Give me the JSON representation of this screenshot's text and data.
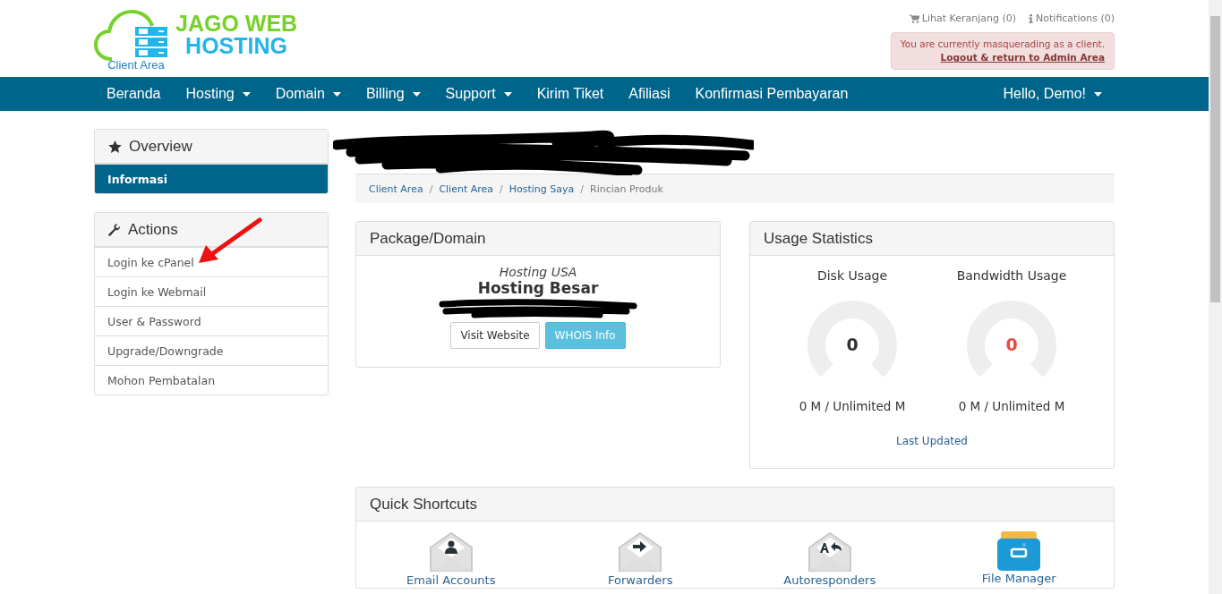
{
  "header": {
    "logo": {
      "line1": "JAGO WEB",
      "line2": "HOSTING",
      "caption": "Client Area"
    },
    "top_links": [
      {
        "kind": "cart",
        "label": "Lihat Keranjang (0)"
      },
      {
        "kind": "info",
        "label": "Notifications (0)"
      }
    ],
    "masquerade": {
      "message": "You are currently masquerading as a client.",
      "link": "Logout & return to Admin Area"
    }
  },
  "nav": {
    "items": [
      {
        "label": "Beranda",
        "dropdown": false
      },
      {
        "label": "Hosting",
        "dropdown": true
      },
      {
        "label": "Domain",
        "dropdown": true
      },
      {
        "label": "Billing",
        "dropdown": true
      },
      {
        "label": "Support",
        "dropdown": true
      },
      {
        "label": "Kirim Tiket",
        "dropdown": false
      },
      {
        "label": "Afiliasi",
        "dropdown": false
      },
      {
        "label": "Konfirmasi Pembayaran",
        "dropdown": false
      }
    ],
    "user": {
      "label": "Hello, Demo!",
      "dropdown": true
    }
  },
  "sidebar": [
    {
      "title": "Overview",
      "kind": "overview",
      "items": [
        {
          "label": "Informasi",
          "selected": true
        }
      ]
    },
    {
      "title": "Actions",
      "kind": "actions",
      "items": [
        {
          "label": "Login ke cPanel",
          "selected": false
        },
        {
          "label": "Login ke Webmail",
          "selected": false
        },
        {
          "label": "User & Password",
          "selected": false
        },
        {
          "label": "Upgrade/Downgrade",
          "selected": false
        },
        {
          "label": "Mohon Pembatalan",
          "selected": false
        }
      ]
    }
  ],
  "breadcrumb": {
    "separator": "/",
    "items": [
      {
        "label": "Client Area",
        "active": false
      },
      {
        "label": "Client Area",
        "active": false
      },
      {
        "label": "Hosting Saya",
        "active": false
      },
      {
        "label": "Rincian Produk",
        "active": true
      }
    ]
  },
  "package": {
    "title": "Package/Domain",
    "group": "Hosting USA",
    "product": "Hosting Besar",
    "buttons": [
      {
        "label": "Visit Website",
        "kind": "default"
      },
      {
        "label": "WHOIS Info",
        "kind": "info"
      }
    ]
  },
  "usage": {
    "title": "Usage Statistics",
    "gauges": [
      {
        "label": "Disk Usage",
        "value": "0",
        "color": "#333333",
        "level": 0,
        "reading": "0 M / Unlimited M"
      },
      {
        "label": "Bandwidth Usage",
        "value": "0",
        "color": "#e74c3c",
        "level": 0,
        "reading": "0 M / Unlimited M"
      }
    ],
    "footer": "Last Updated"
  },
  "shortcuts": {
    "title": "Quick Shortcuts",
    "items": [
      {
        "kind": "accounts",
        "label": "Email Accounts"
      },
      {
        "kind": "forwarders",
        "label": "Forwarders"
      },
      {
        "kind": "autoresponders",
        "label": "Autoresponders"
      },
      {
        "kind": "files",
        "label": "File Manager"
      }
    ]
  }
}
